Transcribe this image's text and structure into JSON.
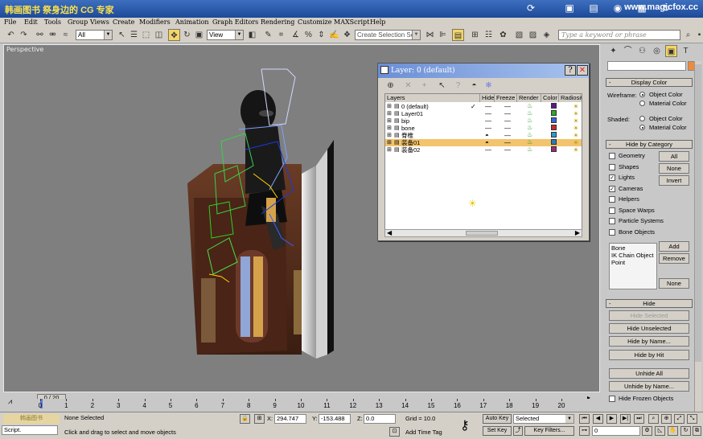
{
  "app": {
    "title": "韩画图书 祭身边的 CG 专家",
    "brand": "www.magicfox.cc"
  },
  "menu": [
    "File",
    "Edit",
    "Tools",
    "Group",
    "Views",
    "Create",
    "Modifiers",
    "Animation",
    "Graph Editors",
    "Rendering",
    "Customize",
    "MAXScript",
    "Help"
  ],
  "toolbar": {
    "filter_value": "All",
    "refcoord_value": "View",
    "selection_set_placeholder": "Create Selection Set",
    "keyword_placeholder": "Type a keyword or phrase"
  },
  "viewport": {
    "label": "Perspective"
  },
  "layer_dialog": {
    "title": "Layer: 0 (default)",
    "columns": [
      "Layers",
      "Hide",
      "Freeze",
      "Render",
      "Color",
      "Radiosit"
    ],
    "rows": [
      {
        "name": "0 (default)",
        "current": true,
        "hidden": false,
        "color": "#5a1a8a"
      },
      {
        "name": "Layer01",
        "current": false,
        "hidden": false,
        "color": "#2aa82a"
      },
      {
        "name": "bip",
        "current": false,
        "hidden": false,
        "color": "#2a6ad8"
      },
      {
        "name": "bone",
        "current": false,
        "hidden": false,
        "color": "#c82a2a"
      },
      {
        "name": "脊椎",
        "current": false,
        "hidden": true,
        "color": "#2a9acb"
      },
      {
        "name": "装备01",
        "current": false,
        "hidden": true,
        "color": "#2a7ab8",
        "selected": true
      },
      {
        "name": "装备02",
        "current": false,
        "hidden": false,
        "color": "#9a2a7a"
      }
    ]
  },
  "command_panel": {
    "display_color": {
      "title": "Display Color",
      "wireframe_label": "Wireframe:",
      "shaded_label": "Shaded:",
      "object_color": "Object Color",
      "material_color": "Material Color"
    },
    "hide_by_category": {
      "title": "Hide by Category",
      "items": [
        {
          "label": "Geometry",
          "checked": false
        },
        {
          "label": "Shapes",
          "checked": false
        },
        {
          "label": "Lights",
          "checked": true
        },
        {
          "label": "Cameras",
          "checked": true
        },
        {
          "label": "Helpers",
          "checked": false
        },
        {
          "label": "Space Warps",
          "checked": false
        },
        {
          "label": "Particle Systems",
          "checked": false
        },
        {
          "label": "Bone Objects",
          "checked": false
        }
      ],
      "all": "All",
      "none": "None",
      "invert": "Invert",
      "list": [
        "Bone",
        "IK Chain Object",
        "Point"
      ],
      "add": "Add",
      "remove": "Remove",
      "none2": "None"
    },
    "hide": {
      "title": "Hide",
      "hide_selected": "Hide Selected",
      "hide_unselected": "Hide Unselected",
      "hide_by_name": "Hide by Name...",
      "hide_by_hit": "Hide by Hit",
      "unhide_all": "Unhide All",
      "unhide_by_name": "Unhide by Name...",
      "hide_frozen": "Hide Frozen Objects"
    }
  },
  "timeline": {
    "frame_counter": "0 / 20",
    "ticks": [
      "0",
      "1",
      "2",
      "3",
      "4",
      "5",
      "6",
      "7",
      "8",
      "9",
      "10",
      "11",
      "12",
      "13",
      "14",
      "15",
      "16",
      "17",
      "18",
      "19",
      "20"
    ]
  },
  "status": {
    "selection": "None Selected",
    "prompt": "Click and drag to select and move objects",
    "script_label": "Script.",
    "x_value": "294.747",
    "y_value": "-153.488",
    "z_value": "0.0",
    "grid": "Grid = 10.0",
    "add_time_tag": "Add Time Tag",
    "auto_key": "Auto Key",
    "set_key": "Set Key",
    "selected_value": "Selected",
    "key_filters": "Key Filters...",
    "frame_value": "0"
  }
}
